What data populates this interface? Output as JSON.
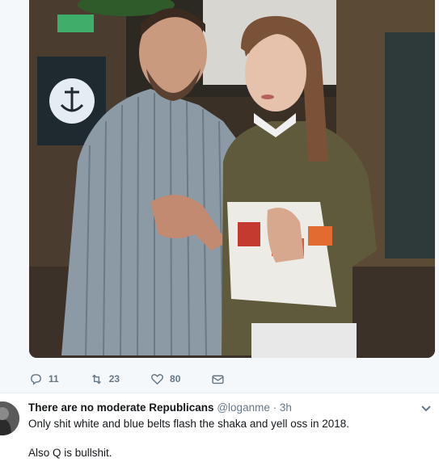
{
  "tweet": {
    "actions": {
      "replies": "11",
      "retweets": "23",
      "likes": "80"
    }
  },
  "reply": {
    "display_name": "There are no moderate Republicans",
    "handle": "@loganme",
    "separator": "·",
    "time": "3h",
    "text_line1": "Only shit white and blue belts flash the shaka and yell oss in 2018.",
    "text_line2": "Also Q is bullshit."
  },
  "colors": {
    "muted": "#657786",
    "text": "#14171a",
    "tweet_bg": "#f5f8fa"
  },
  "icons": [
    "reply-icon",
    "retweet-icon",
    "like-icon",
    "dm-icon",
    "chevron-down-icon"
  ]
}
